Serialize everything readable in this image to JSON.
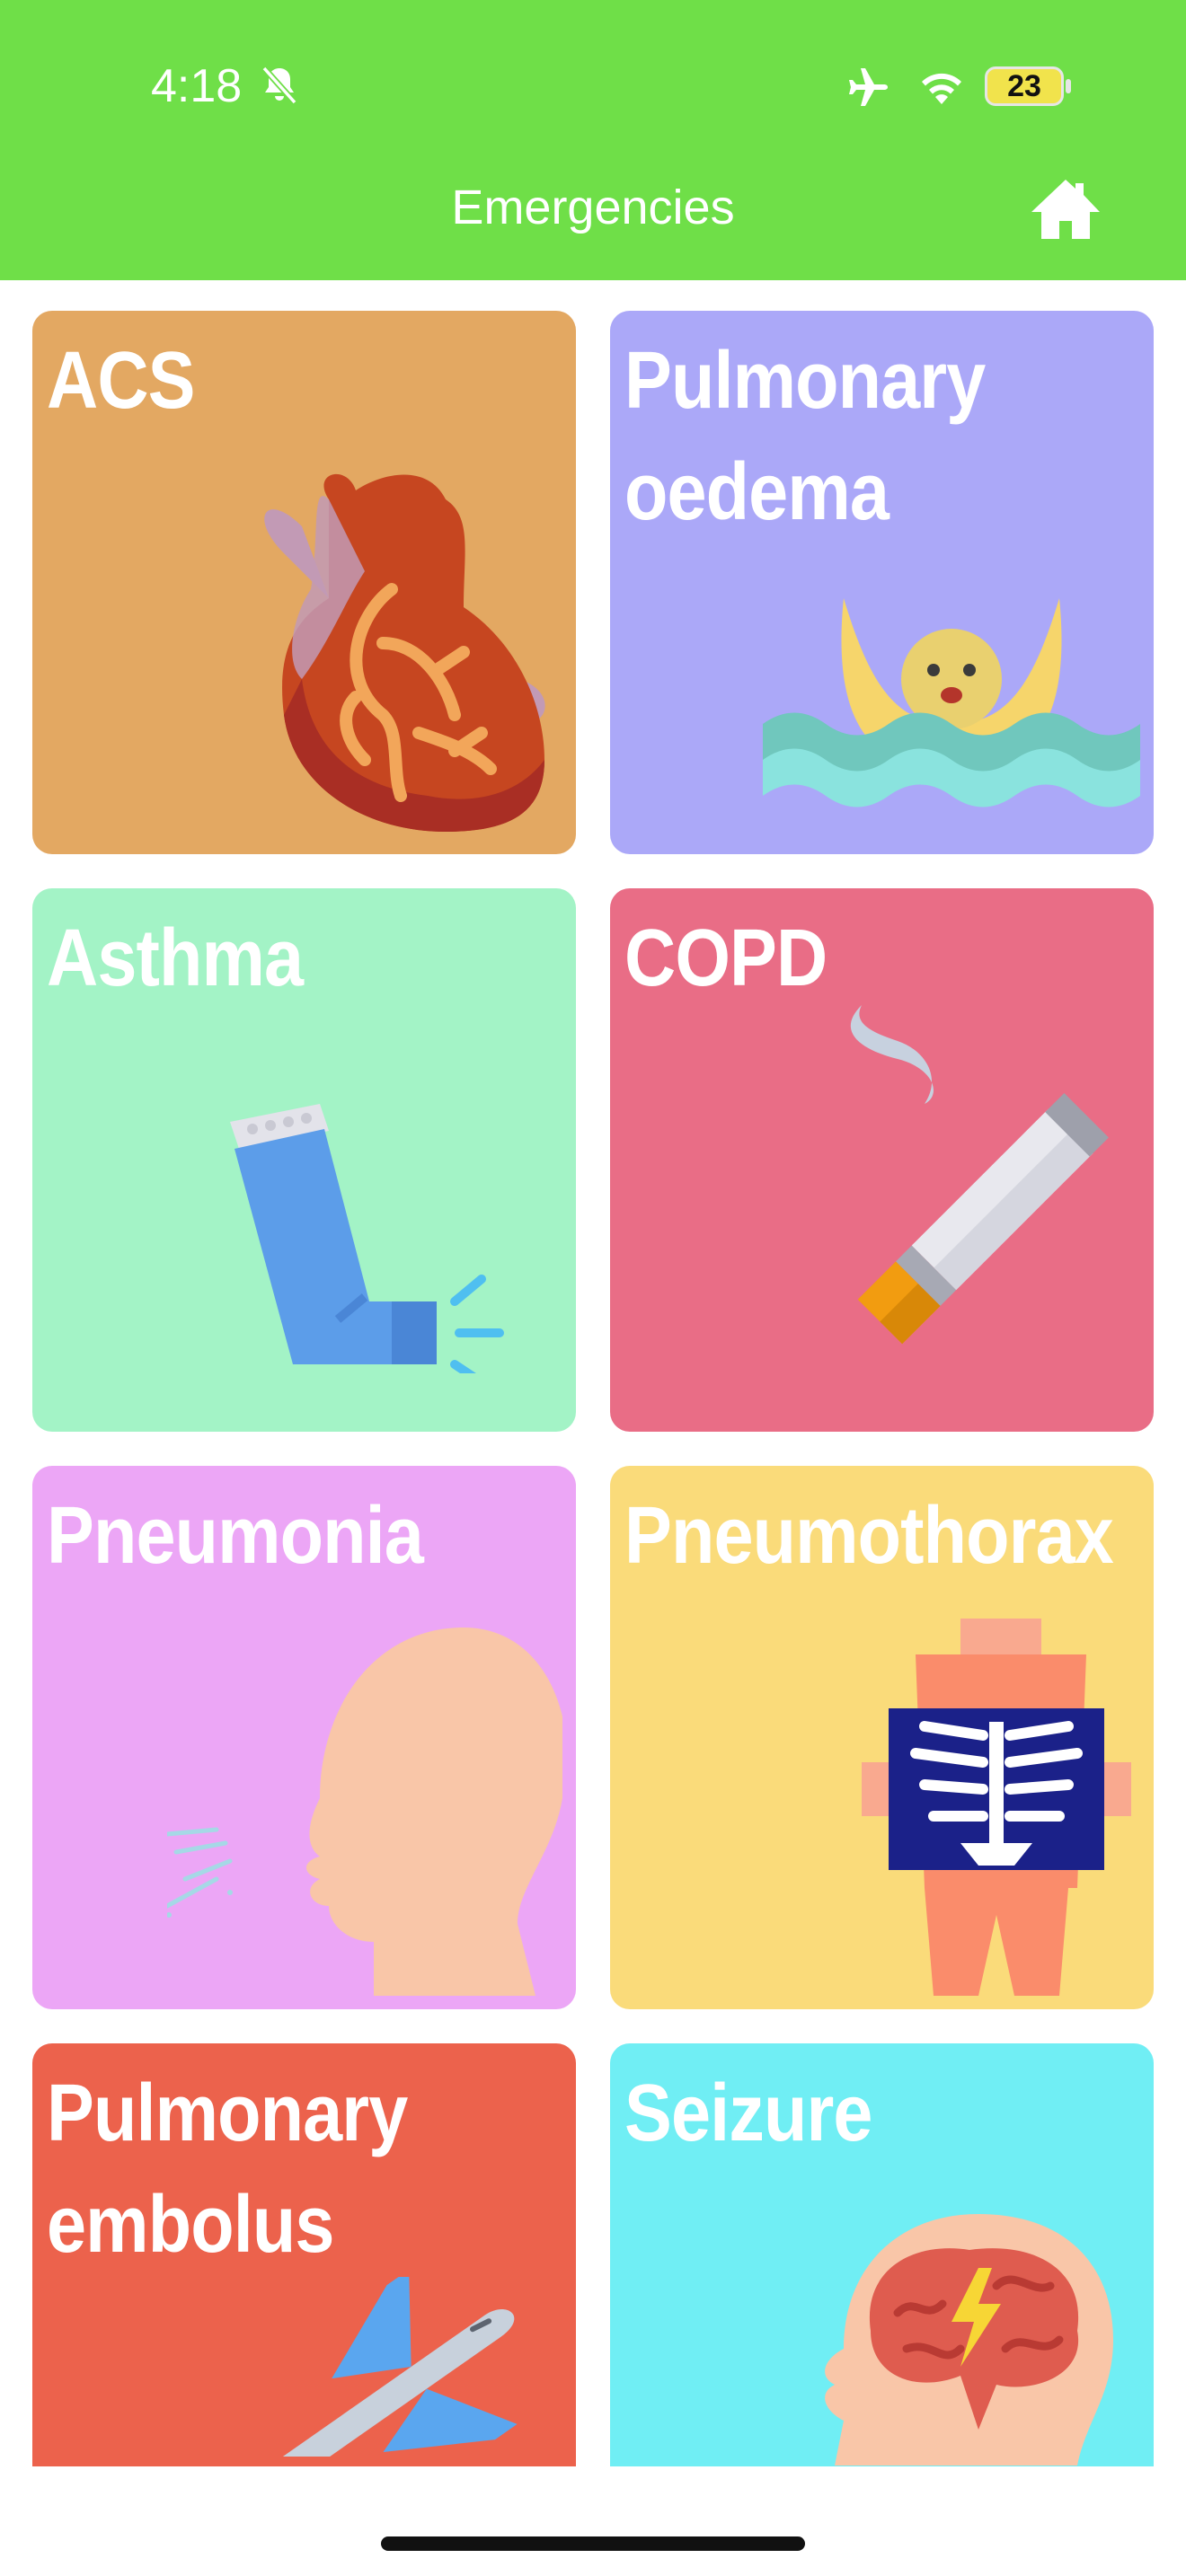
{
  "status_bar": {
    "time": "4:18",
    "battery": "23"
  },
  "header": {
    "title": "Emergencies"
  },
  "cards": [
    {
      "line1": "ACS",
      "line2": "",
      "color": "#e3a862",
      "icon": "heart-icon"
    },
    {
      "line1": "Pulmonary",
      "line2": "oedema",
      "color": "#aba8f8",
      "icon": "drowning-person-icon"
    },
    {
      "line1": "Asthma",
      "line2": "",
      "color": "#a3f3c6",
      "icon": "inhaler-icon"
    },
    {
      "line1": "COPD",
      "line2": "",
      "color": "#e96d86",
      "icon": "cigarette-icon"
    },
    {
      "line1": "Pneumonia",
      "line2": "",
      "color": "#eca6f6",
      "icon": "coughing-head-icon"
    },
    {
      "line1": "Pneumothorax",
      "line2": "",
      "color": "#fadb7a",
      "icon": "chest-xray-icon"
    },
    {
      "line1": "Pulmonary",
      "line2": "embolus",
      "color": "#ec624c",
      "icon": "airplane-icon"
    },
    {
      "line1": "Seizure",
      "line2": "",
      "color": "#70eef4",
      "icon": "brain-lightning-icon"
    }
  ]
}
